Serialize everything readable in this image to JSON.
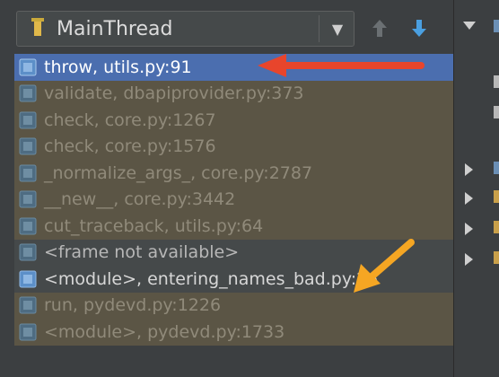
{
  "toolbar": {
    "thread_name": "MainThread",
    "dropdown_icon": "chevron-down-icon",
    "up_icon": "arrow-up-icon",
    "down_icon": "arrow-down-icon"
  },
  "frames": [
    {
      "label": "throw, utils.py:91",
      "kind": "selected"
    },
    {
      "label": "validate, dbapiprovider.py:373",
      "kind": "library"
    },
    {
      "label": "check, core.py:1267",
      "kind": "library"
    },
    {
      "label": "check, core.py:1576",
      "kind": "library"
    },
    {
      "label": "_normalize_args_, core.py:2787",
      "kind": "library"
    },
    {
      "label": "__new__, core.py:3442",
      "kind": "library"
    },
    {
      "label": "cut_traceback, utils.py:64",
      "kind": "library"
    },
    {
      "label": "<frame not available>",
      "kind": "plain"
    },
    {
      "label": "<module>, entering_names_bad.py:26",
      "kind": "plain"
    },
    {
      "label": "run, pydevd.py:1226",
      "kind": "library"
    },
    {
      "label": "<module>, pydevd.py:1733",
      "kind": "library"
    }
  ],
  "colors": {
    "selected_row": "#4b6eaf",
    "library_row": "#5b5545",
    "red_arrow": "#e8452c",
    "orange_arrow": "#f5a623"
  }
}
